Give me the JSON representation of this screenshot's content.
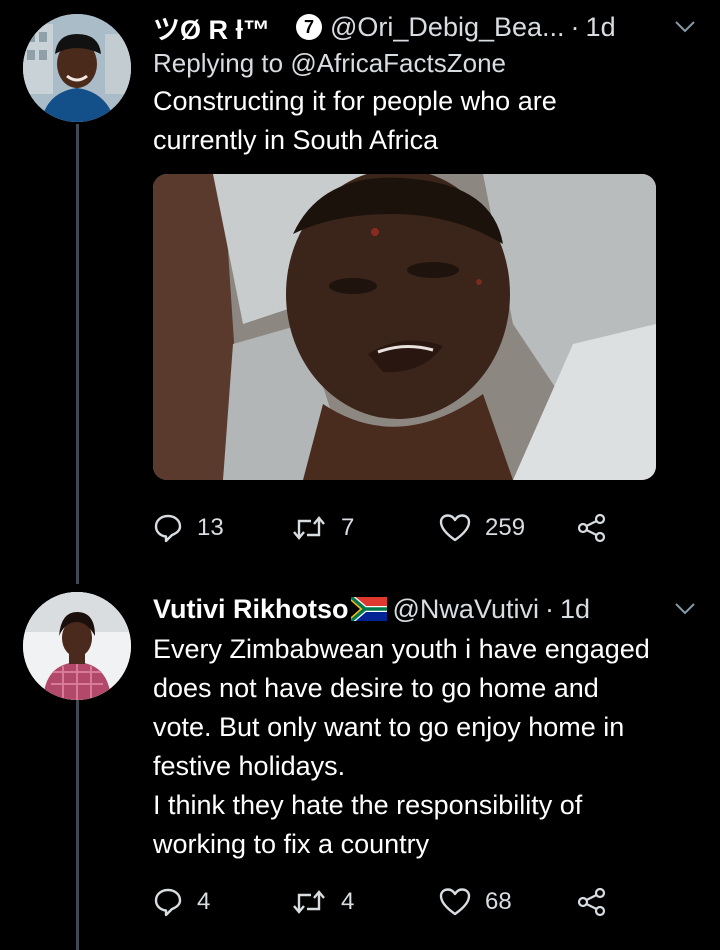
{
  "colors": {
    "background": "#000000",
    "text_primary": "#ffffff",
    "text_secondary": "#d8dde2",
    "thread_line": "#3d4a55"
  },
  "tweets": [
    {
      "display_name": "ツØ R ƚ™",
      "badge": "7",
      "handle": "@Ori_Debig_Bea...",
      "separator": "·",
      "time": "1d",
      "replying_prefix": "Replying to",
      "replying_to": "@AfricaFactsZone",
      "body_lines": [
        "Constructing it for people who are",
        "currently in South Africa"
      ],
      "replies": "13",
      "retweets": "7",
      "likes": "259",
      "icons": [
        "reply-icon",
        "retweet-icon",
        "like-icon",
        "share-icon"
      ]
    },
    {
      "display_name": "Vutivi Rikhotso",
      "flag": "south-africa-flag-icon",
      "handle": "@NwaVutivi",
      "separator": "·",
      "time": "1d",
      "body_lines": [
        "Every Zimbabwean youth i have engaged",
        "does not have desire to go home and",
        "vote. But only want to go enjoy home in",
        "festive holidays.",
        "I think they hate the responsibility of",
        "working to fix a country"
      ],
      "replies": "4",
      "retweets": "4",
      "likes": "68",
      "icons": [
        "reply-icon",
        "retweet-icon",
        "like-icon",
        "share-icon"
      ]
    }
  ]
}
